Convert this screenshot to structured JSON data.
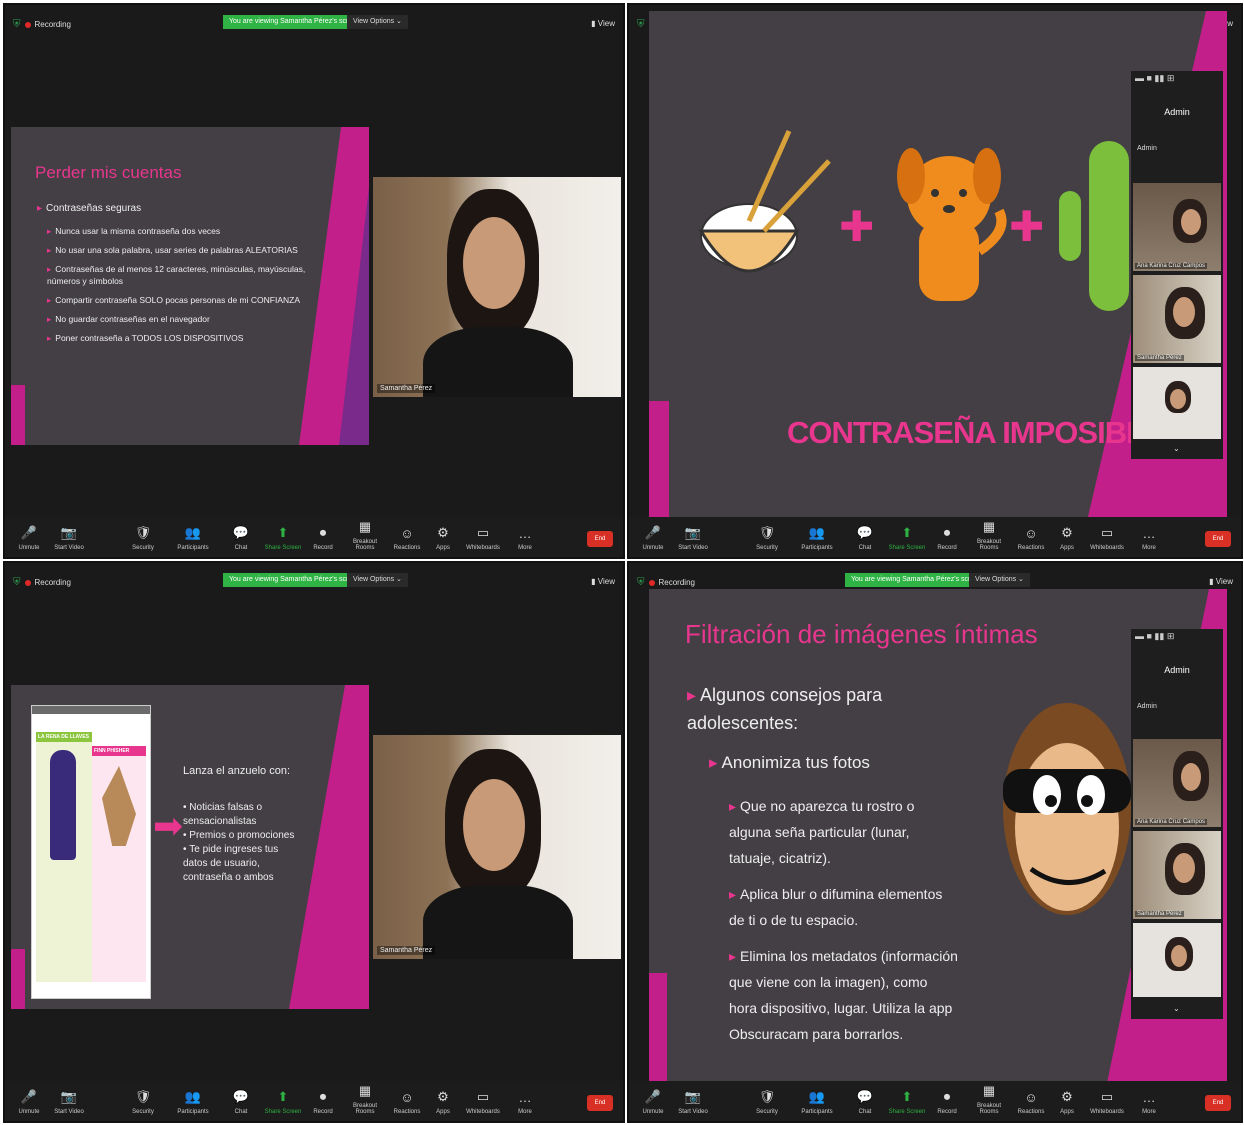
{
  "common": {
    "recording": "Recording",
    "banner": "You are viewing Samantha Pérez's screen",
    "view_options": "View Options ⌄",
    "view": "View",
    "end": "End",
    "toolbar": [
      {
        "icon": "🎤",
        "label": "Unmute"
      },
      {
        "icon": "📷",
        "label": "Start Video"
      },
      {
        "icon": "🛡",
        "label": "Security"
      },
      {
        "icon": "👥",
        "label": "Participants"
      },
      {
        "icon": "💬",
        "label": "Chat"
      },
      {
        "icon": "⬆",
        "label": "Share Screen"
      },
      {
        "icon": "⏺",
        "label": "Record"
      },
      {
        "icon": "▦",
        "label": "Breakout Rooms"
      },
      {
        "icon": "☺",
        "label": "Reactions"
      },
      {
        "icon": "⚙",
        "label": "Apps"
      },
      {
        "icon": "▭",
        "label": "Whiteboards"
      },
      {
        "icon": "…",
        "label": "More"
      }
    ]
  },
  "panel1": {
    "slide_title": "Perder mis cuentas",
    "main_bullet": "Contraseñas seguras",
    "sub_bullets": [
      "Nunca usar la misma contraseña dos veces",
      "No usar una sola palabra, usar series de palabras ALEATORIAS",
      "Contraseñas de al menos 12 caracteres, minúsculas, mayúsculas, números y símbolos",
      "Compartir contraseña SOLO pocas personas de mi CONFIANZA",
      "No guardar contraseñas en el navegador",
      "Poner contraseña a TODOS LOS DISPOSITIVOS"
    ],
    "speaker_name": "Samantha Pérez"
  },
  "panel2": {
    "slide_text": "CONTRASEÑA IMPOSIBLE",
    "plus": "✚",
    "gallery_title": "Admin",
    "gallery_host": "Admin",
    "tiles": [
      "Ana Karina Cruz Campos",
      "Samantha Pérez",
      ""
    ]
  },
  "panel3": {
    "poster_title": "LA RENA DE LLAVES",
    "poster_title2": "FINN PHISHER",
    "lead": "Lanza el anzuelo con:",
    "bullets": [
      "Noticias falsas o sensacionalistas",
      "Premios o promociones",
      "Te pide ingreses tus datos de usuario, contraseña o ambos"
    ],
    "speaker_name": "Samantha Pérez"
  },
  "panel4": {
    "slide_title": "Filtración de imágenes íntimas",
    "l1": "Algunos consejos para adolescentes:",
    "l2": "Anonimiza tus fotos",
    "l3": [
      "Que no aparezca tu rostro o alguna seña particular (lunar, tatuaje, cicatriz).",
      "Aplica blur o difumina elementos de ti o de tu espacio.",
      "Elimina los metadatos (información que viene con la imagen), como hora dispositivo, lugar. Utiliza la app Obscuracam para borrarlos."
    ],
    "gallery_title": "Admin",
    "gallery_host": "Admin",
    "tiles": [
      "Ana Karina Cruz Campos",
      "Samantha Pérez",
      ""
    ]
  }
}
